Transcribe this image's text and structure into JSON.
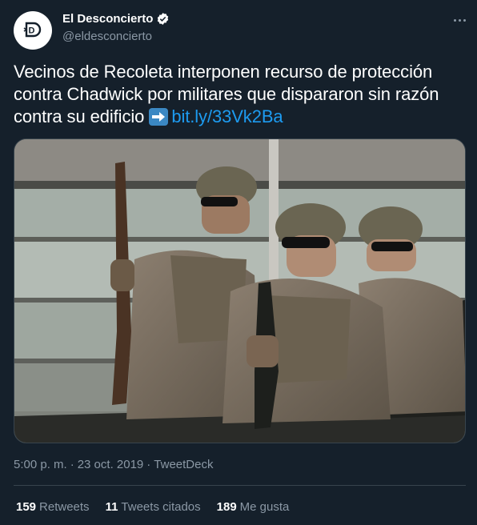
{
  "author": {
    "display_name": "El Desconcierto",
    "handle": "@eldesconcierto",
    "avatar_letter": "D",
    "verified_icon": "verified-badge-icon"
  },
  "tweet": {
    "text_line": "Vecinos de Recoleta interponen recurso de protección contra Chadwick por militares que dispararon sin razón contra su edificio",
    "arrow_icon": "right-arrow-emoji-icon",
    "link": "bit.ly/33Vk2Ba"
  },
  "media": {
    "description_icon": "photo-soldiers-in-armored-vehicle"
  },
  "meta": {
    "time": "5:00 p. m.",
    "separator": "·",
    "date": "23 oct. 2019",
    "source": "TweetDeck"
  },
  "stats": {
    "retweets_count": "159",
    "retweets_label": "Retweets",
    "quotes_count": "11",
    "quotes_label": "Tweets citados",
    "likes_count": "189",
    "likes_label": "Me gusta"
  },
  "colors": {
    "background": "#15202b",
    "link": "#1d9bf0",
    "secondary_text": "#8b98a5",
    "divider": "#38444d"
  }
}
